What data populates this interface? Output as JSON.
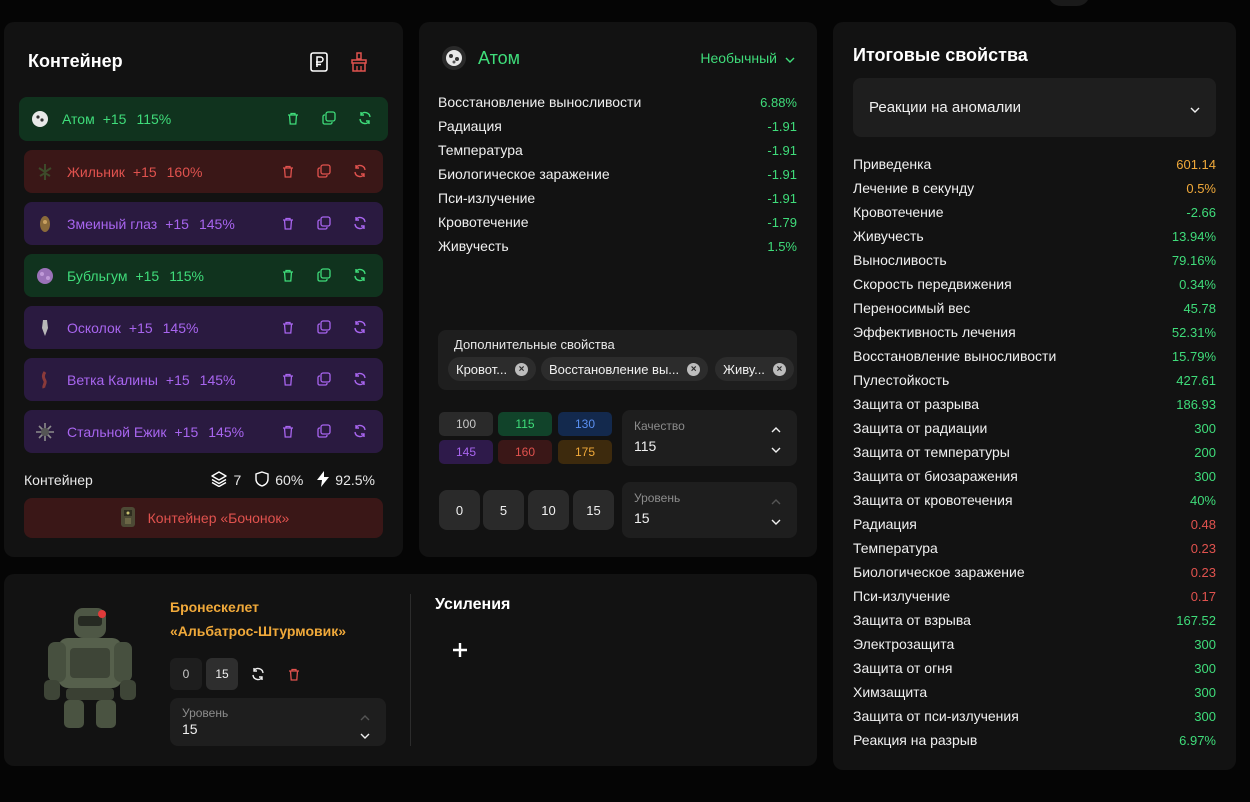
{
  "container": {
    "title": "Контейнер",
    "artifacts": [
      {
        "name": "Атом",
        "plus": "+15",
        "quality": "115%",
        "color": "green"
      },
      {
        "name": "Жильник",
        "plus": "+15",
        "quality": "160%",
        "color": "red"
      },
      {
        "name": "Змеиный глаз",
        "plus": "+15",
        "quality": "145%",
        "color": "purple"
      },
      {
        "name": "Бубльгум",
        "plus": "+15",
        "quality": "115%",
        "color": "green"
      },
      {
        "name": "Осколок",
        "plus": "+15",
        "quality": "145%",
        "color": "purple"
      },
      {
        "name": "Ветка Калины",
        "plus": "+15",
        "quality": "145%",
        "color": "purple"
      },
      {
        "name": "Стальной Ежик",
        "plus": "+15",
        "quality": "145%",
        "color": "purple"
      }
    ],
    "footer_label": "Контейнер",
    "slots": "7",
    "protection": "60%",
    "energy": "92.5%",
    "container_name": "Контейнер «Бочонок»"
  },
  "artifact": {
    "name": "Атом",
    "rarity": "Необычный",
    "properties": [
      {
        "label": "Восстановление выносливости",
        "value": "6.88%",
        "tone": "green"
      },
      {
        "label": "Радиация",
        "value": "-1.91",
        "tone": "green"
      },
      {
        "label": "Температура",
        "value": "-1.91",
        "tone": "green"
      },
      {
        "label": "Биологическое заражение",
        "value": "-1.91",
        "tone": "green"
      },
      {
        "label": "Пси-излучение",
        "value": "-1.91",
        "tone": "green"
      },
      {
        "label": "Кровотечение",
        "value": "-1.79",
        "tone": "green"
      },
      {
        "label": "Живучесть",
        "value": "1.5%",
        "tone": "green"
      }
    ],
    "extra_label": "Дополнительные свойства",
    "extra_chips": [
      "Кровот...",
      "Восстановление вы...",
      "Живу..."
    ],
    "quality_options": [
      "100",
      "115",
      "130",
      "145",
      "160",
      "175"
    ],
    "quality_label": "Качество",
    "quality_value": "115",
    "level_options": [
      "0",
      "5",
      "10",
      "15"
    ],
    "level_label": "Уровень",
    "level_value": "15"
  },
  "armor": {
    "name_line1": "Бронескелет",
    "name_line2": "«Альбатрос-Штурмовик»",
    "level_options": [
      "0",
      "15"
    ],
    "level_label": "Уровень",
    "level_value": "15",
    "boosts_title": "Усиления",
    "add_symbol": "+"
  },
  "totals": {
    "title": "Итоговые свойства",
    "filter": "Реакции на аномалии",
    "rows": [
      {
        "label": "Приведенка",
        "value": "601.14",
        "tone": "orange"
      },
      {
        "label": "Лечение в секунду",
        "value": "0.5%",
        "tone": "orange"
      },
      {
        "label": "Кровотечение",
        "value": "-2.66",
        "tone": "green"
      },
      {
        "label": "Живучесть",
        "value": "13.94%",
        "tone": "green"
      },
      {
        "label": "Выносливость",
        "value": "79.16%",
        "tone": "green"
      },
      {
        "label": "Скорость передвижения",
        "value": "0.34%",
        "tone": "green"
      },
      {
        "label": "Переносимый вес",
        "value": "45.78",
        "tone": "green"
      },
      {
        "label": "Эффективность лечения",
        "value": "52.31%",
        "tone": "green"
      },
      {
        "label": "Восстановление выносливости",
        "value": "15.79%",
        "tone": "green"
      },
      {
        "label": "Пулестойкость",
        "value": "427.61",
        "tone": "green"
      },
      {
        "label": "Защита от разрыва",
        "value": "186.93",
        "tone": "green"
      },
      {
        "label": "Защита от радиации",
        "value": "300",
        "tone": "green"
      },
      {
        "label": "Защита от температуры",
        "value": "200",
        "tone": "green"
      },
      {
        "label": "Защита от биозаражения",
        "value": "300",
        "tone": "green"
      },
      {
        "label": "Защита от кровотечения",
        "value": "40%",
        "tone": "green"
      },
      {
        "label": "Радиация",
        "value": "0.48",
        "tone": "red"
      },
      {
        "label": "Температура",
        "value": "0.23",
        "tone": "red"
      },
      {
        "label": "Биологическое заражение",
        "value": "0.23",
        "tone": "red"
      },
      {
        "label": "Пси-излучение",
        "value": "0.17",
        "tone": "red"
      },
      {
        "label": "Защита от взрыва",
        "value": "167.52",
        "tone": "green"
      },
      {
        "label": "Электрозащита",
        "value": "300",
        "tone": "green"
      },
      {
        "label": "Защита от огня",
        "value": "300",
        "tone": "green"
      },
      {
        "label": "Химзащита",
        "value": "300",
        "tone": "green"
      },
      {
        "label": "Защита от пси-излучения",
        "value": "300",
        "tone": "green"
      },
      {
        "label": "Реакция на разрыв",
        "value": "6.97%",
        "tone": "green"
      }
    ]
  },
  "colors": {
    "green": "#3fdc7a",
    "red": "#e0524e",
    "purple": "#a865ef",
    "orange": "#f0a93a",
    "panel": "#121212"
  },
  "icons": [
    "trash-icon",
    "copy-icon",
    "refresh-icon",
    "ruble-icon",
    "broom-icon",
    "layers-icon",
    "shield-icon",
    "bolt-icon",
    "chevron-down-icon",
    "chevron-up-icon",
    "close-icon",
    "plus-icon"
  ]
}
